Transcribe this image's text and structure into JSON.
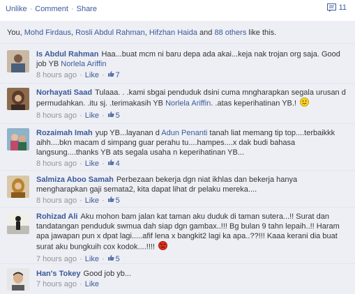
{
  "actions": {
    "unlike": "Unlike",
    "comment": "Comment",
    "share": "Share",
    "comments_count": "11"
  },
  "likes": {
    "you": "You",
    "n1": "Mohd Firdaus",
    "n2": "Rosli Abdul Rahman",
    "n3": "Hifzhan Haida",
    "and": "and",
    "others": "88 others",
    "suffix": "like this."
  },
  "comments": [
    {
      "author": "Is Abdul Rahman",
      "text1": "Haa...buat mcm ni baru depa ada akai...keja nak trojan org saja. Good job YB",
      "tag": "Norlela Ariffin",
      "time": "8 hours ago",
      "like": "Like",
      "likes": "7"
    },
    {
      "author": "Norhayati Saad",
      "text1": "Tulaaa. . .kami sbgai penduduk dsini cuma mngharapkan segala urusan d permudahkan. .itu sj. .terimakasih YB",
      "tag": "Norlela Ariffin",
      "text2": ". .atas keperihatinan YB.!",
      "time": "8 hours ago",
      "like": "Like",
      "likes": "5",
      "emoji": "smile"
    },
    {
      "author": "Rozaimah Imah",
      "text1": "yup YB...layanan d",
      "tag": "Adun Penanti",
      "text2": "tanah liat memang tip top....terbaikkk aihh....bkn macam d simpang guar perahu tu....hampes....x dak budi bahasa langsung....thanks YB ats segala usaha n keperihatinan YB...",
      "time": "8 hours ago",
      "like": "Like",
      "likes": "4"
    },
    {
      "author": "Salmiza Aboo Samah",
      "text1": "Perbezaan bekerja dgn niat ikhlas dan bekerja hanya mengharapkan gaji semata2, kita dapat lihat dr pelaku mereka....",
      "time": "8 hours ago",
      "like": "Like",
      "likes": "5"
    },
    {
      "author": "Rohizad Ali",
      "text1": "Aku mohon bam jalan kat taman aku duduk di taman sutera...!! Surat dan tandatangan penduduk swmua dah siap dgn gambax..!!! Bg bulan 9 tahn lepaih..!! Haram apa jawapan pun x dpat lagi.....afif lena x bangkit2 lagi ka apa..??!!! Kaaa kerani dia buat surat aku bungkuih cox kodok....!!!!",
      "time": "7 hours ago",
      "like": "Like",
      "likes": "5",
      "emoji": "angry"
    },
    {
      "author": "Han's Tokey",
      "text1": "Good job yb...",
      "time": "7 hours ago",
      "like": "Like"
    }
  ]
}
